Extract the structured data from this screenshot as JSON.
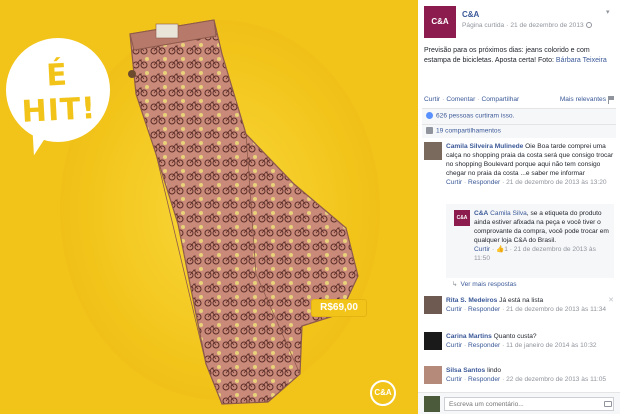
{
  "photo": {
    "bubble_text": "É HIT!",
    "price": "R$69,00",
    "logo_text": "C&A"
  },
  "post": {
    "page_name": "C&A",
    "avatar_text": "C&A",
    "meta_type": "Página curtida",
    "meta_date": "21 de dezembro de 2013",
    "text_part1": "Previsão para os próximos dias: jeans colorido e com",
    "text_part2": "estampa de bicicletas. Aposta certa! Foto:",
    "text_link": "Bárbara Teixeira"
  },
  "actions": {
    "like": "Curtir",
    "comment": "Comentar",
    "share": "Compartilhar",
    "more": "Mais relevantes"
  },
  "stats": {
    "likes": "626 pessoas curtiram isso.",
    "shares": "19 compartilhamentos"
  },
  "comments": [
    {
      "name": "Camila Silveira Mulinede",
      "text": "Oie Boa tarde comprei uma calça no shopping praia da costa será que consigo trocar no shopping Boulevard porque aqui não tem consigo chegar no praia da costa ...e saber me informar",
      "like": "Curtir",
      "reply": "Responder",
      "time": "21 de dezembro de 2013 às 13:20"
    },
    {
      "name": "C&A",
      "tag": "Camila Silva",
      "text": ", se a etiqueta do produto ainda estiver afixada na peça e você tiver o comprovante da compra, você pode trocar em qualquer loja C&A do Brasil.",
      "like": "Curtir",
      "likes_count": "1",
      "time": "21 de dezembro de 2013 às 11:50",
      "avatar_text": "C&A"
    },
    {
      "more_replies": "Ver mais respostas"
    },
    {
      "name": "Rita S. Medeiros",
      "text": "Já está na lista",
      "like": "Curtir",
      "reply": "Responder",
      "time": "21 de dezembro de 2013 às 11:34"
    },
    {
      "name": "Carina Martins",
      "text": "Quanto custa?",
      "like": "Curtir",
      "reply": "Responder",
      "time": "11 de janeiro de 2014 às 10:32"
    },
    {
      "name": "Silsa Santos",
      "text": "lindo",
      "like": "Curtir",
      "reply": "Responder",
      "time": "22 de dezembro de 2013 às 11:05"
    }
  ],
  "composer": {
    "placeholder": "Escreva um comentário..."
  }
}
